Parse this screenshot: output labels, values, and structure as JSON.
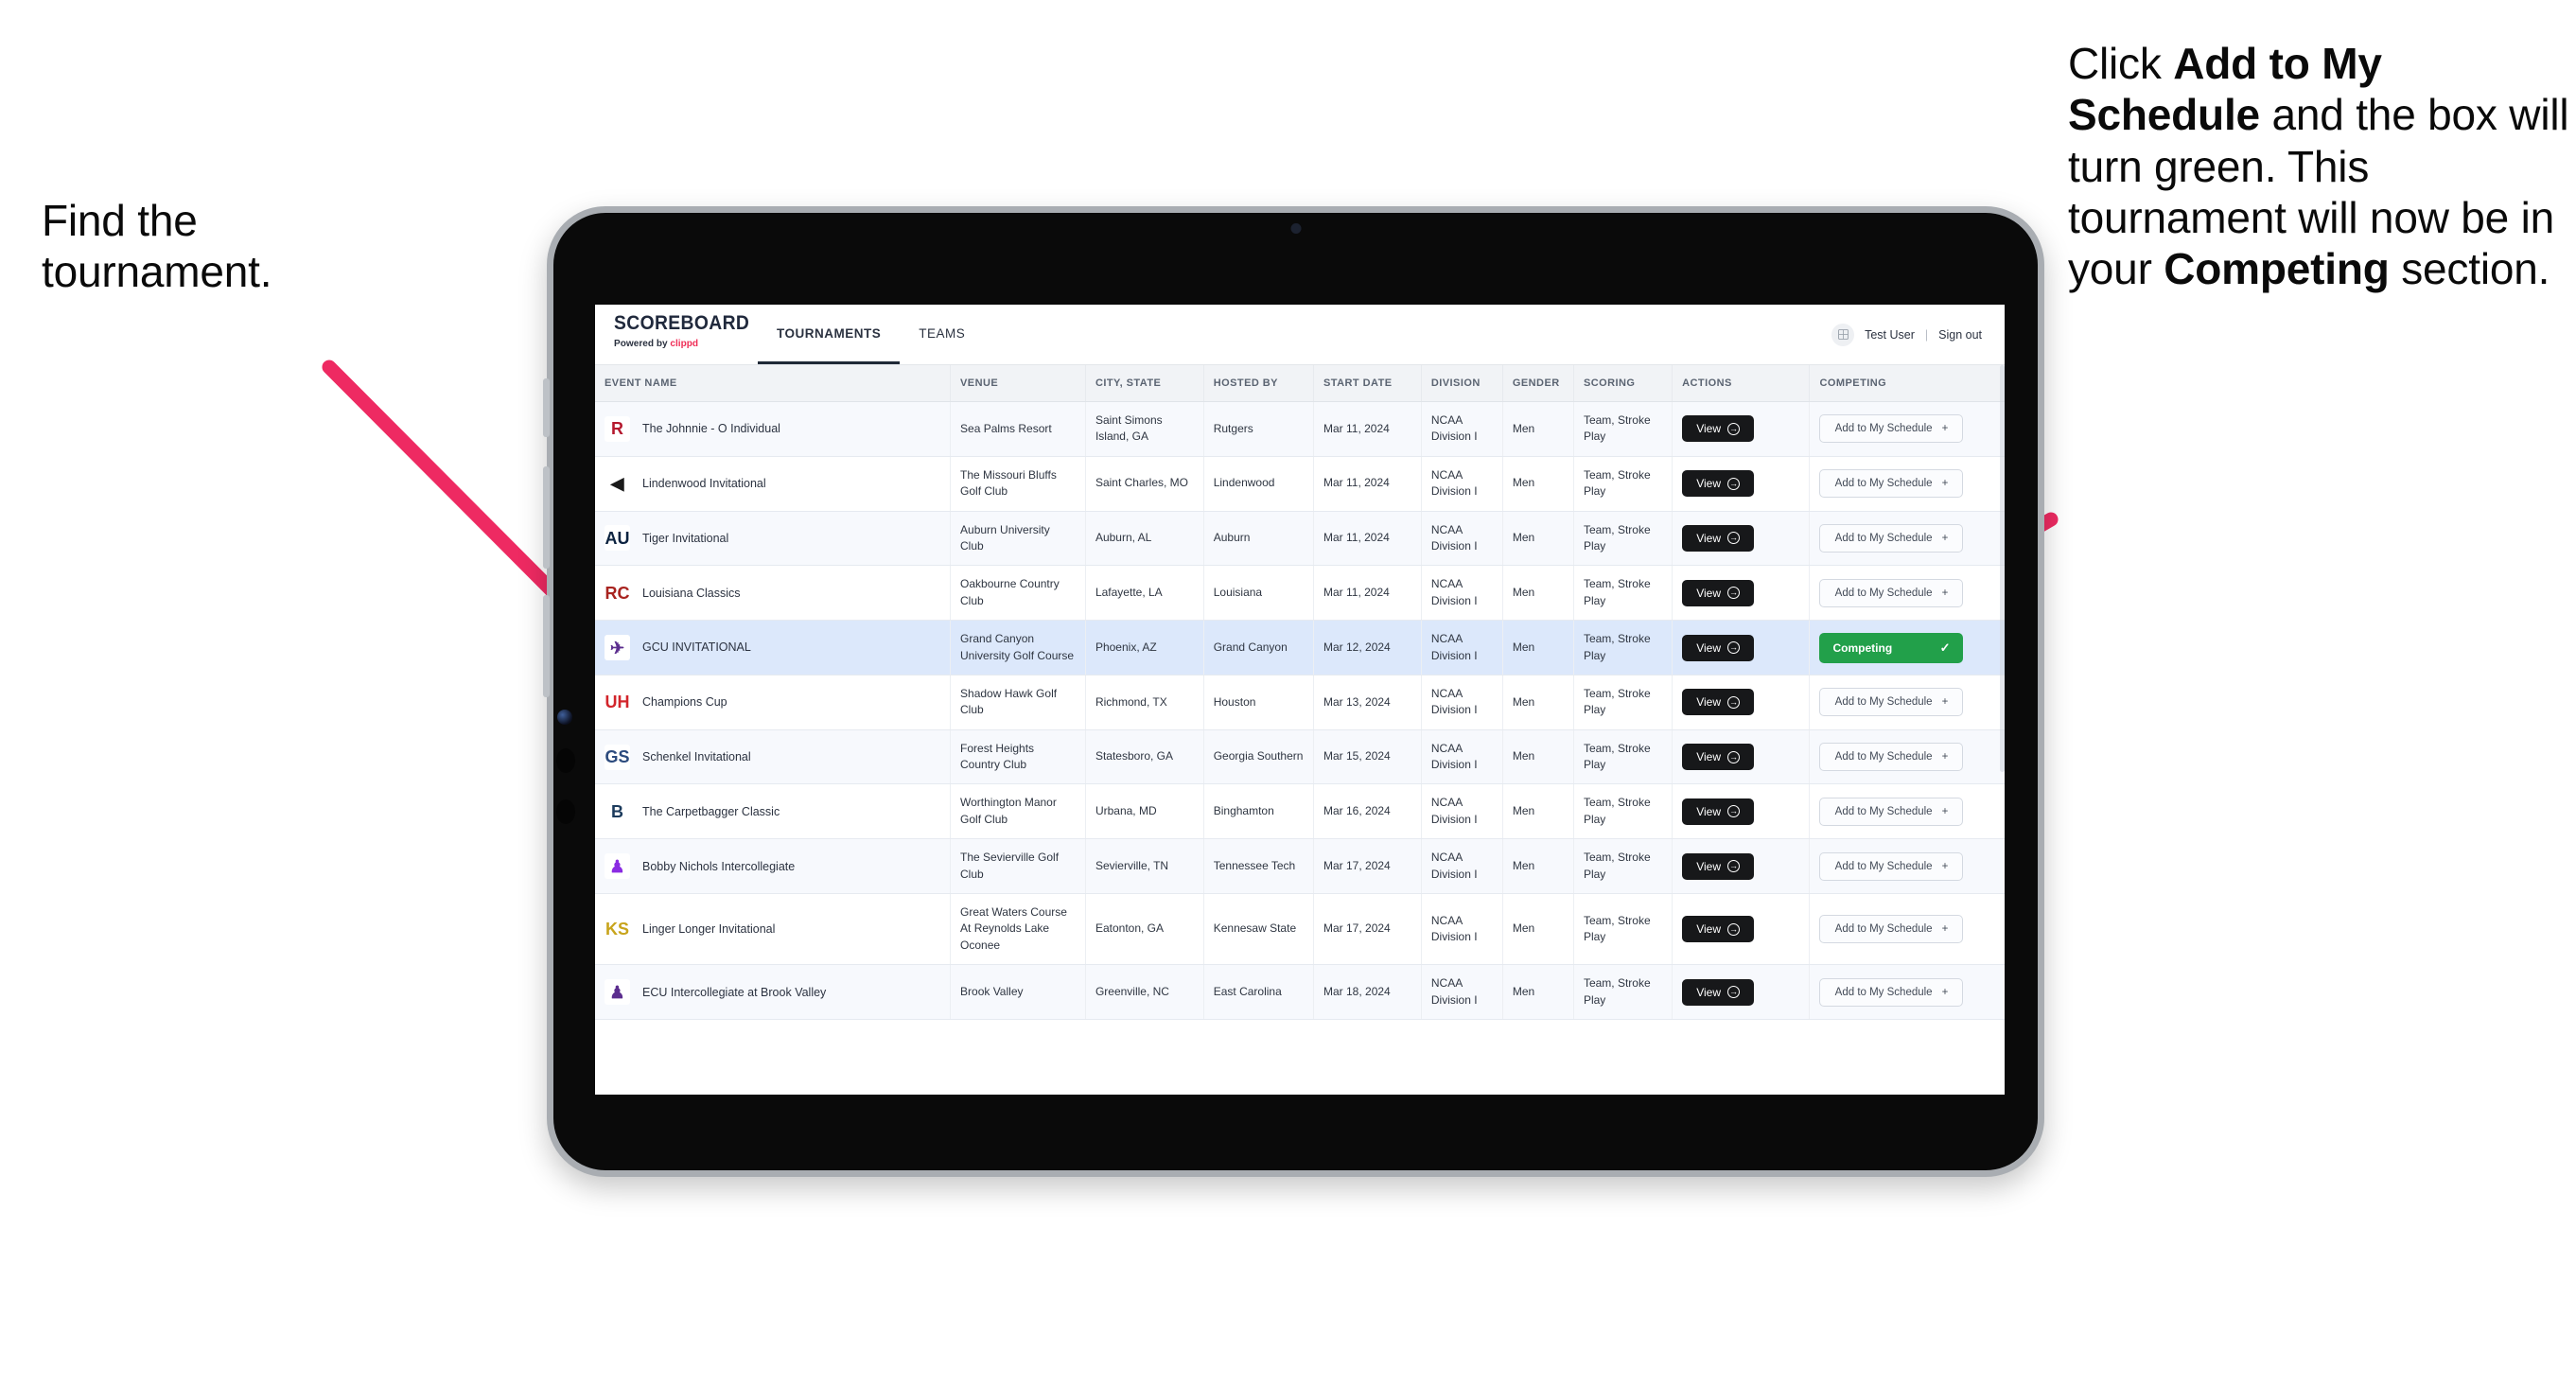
{
  "annotations": {
    "left": {
      "line1": "Find the",
      "line2": "tournament."
    },
    "right": {
      "p1_pre": "Click ",
      "p1_bold": "Add to My Schedule",
      "p1_post": " and the box will turn green. This tournament will now be in your ",
      "p2_bold": "Competing",
      "p2_post": " section."
    }
  },
  "colors": {
    "arrow": "#ee2a62",
    "competing_green": "#22a04a",
    "accent_clippd": "#ef2d56",
    "row_highlight": "#dce8fb",
    "button_dark": "#17181a"
  },
  "app": {
    "brand": {
      "title": "SCOREBOARD",
      "powered_prefix": "Powered by ",
      "powered_brand": "clippd"
    },
    "nav": [
      {
        "label": "TOURNAMENTS",
        "active": true
      },
      {
        "label": "TEAMS",
        "active": false
      }
    ],
    "header_right": {
      "avatar_icon": "user-grid-icon",
      "user": "Test User",
      "separator": "|",
      "signout": "Sign out"
    },
    "table": {
      "columns": [
        "EVENT NAME",
        "VENUE",
        "CITY, STATE",
        "HOSTED BY",
        "START DATE",
        "DIVISION",
        "GENDER",
        "SCORING",
        "ACTIONS",
        "COMPETING"
      ],
      "action_label": "View",
      "add_label": "Add to My Schedule",
      "add_icon": "plus-icon",
      "competing_label": "Competing",
      "competing_icon": "check-icon",
      "rows": [
        {
          "event": "The Johnnie - O Individual",
          "logo": "R",
          "logo_bg": "#ffffff",
          "logo_fg": "#b4182d",
          "venue": "Sea Palms Resort",
          "city": "Saint Simons Island, GA",
          "host": "Rutgers",
          "date": "Mar 11, 2024",
          "division": "NCAA Division I",
          "gender": "Men",
          "scoring": "Team, Stroke Play",
          "competing": false,
          "highlight": false
        },
        {
          "event": "Lindenwood Invitational",
          "logo": "◀",
          "logo_bg": "#ffffff",
          "logo_fg": "#1a1a1a",
          "venue": "The Missouri Bluffs Golf Club",
          "city": "Saint Charles, MO",
          "host": "Lindenwood",
          "date": "Mar 11, 2024",
          "division": "NCAA Division I",
          "gender": "Men",
          "scoring": "Team, Stroke Play",
          "competing": false,
          "highlight": false
        },
        {
          "event": "Tiger Invitational",
          "logo": "AU",
          "logo_bg": "#ffffff",
          "logo_fg": "#0c2340",
          "venue": "Auburn University Club",
          "city": "Auburn, AL",
          "host": "Auburn",
          "date": "Mar 11, 2024",
          "division": "NCAA Division I",
          "gender": "Men",
          "scoring": "Team, Stroke Play",
          "competing": false,
          "highlight": false
        },
        {
          "event": "Louisiana Classics",
          "logo": "RC",
          "logo_bg": "#ffffff",
          "logo_fg": "#a8231f",
          "venue": "Oakbourne Country Club",
          "city": "Lafayette, LA",
          "host": "Louisiana",
          "date": "Mar 11, 2024",
          "division": "NCAA Division I",
          "gender": "Men",
          "scoring": "Team, Stroke Play",
          "competing": false,
          "highlight": false
        },
        {
          "event": "GCU INVITATIONAL",
          "logo": "✈",
          "logo_bg": "#ffffff",
          "logo_fg": "#5b2d8e",
          "venue": "Grand Canyon University Golf Course",
          "city": "Phoenix, AZ",
          "host": "Grand Canyon",
          "date": "Mar 12, 2024",
          "division": "NCAA Division I",
          "gender": "Men",
          "scoring": "Team, Stroke Play",
          "competing": true,
          "highlight": true
        },
        {
          "event": "Champions Cup",
          "logo": "UH",
          "logo_bg": "#ffffff",
          "logo_fg": "#d2252b",
          "venue": "Shadow Hawk Golf Club",
          "city": "Richmond, TX",
          "host": "Houston",
          "date": "Mar 13, 2024",
          "division": "NCAA Division I",
          "gender": "Men",
          "scoring": "Team, Stroke Play",
          "competing": false,
          "highlight": false
        },
        {
          "event": "Schenkel Invitational",
          "logo": "GS",
          "logo_bg": "#ffffff",
          "logo_fg": "#2b4a7d",
          "venue": "Forest Heights Country Club",
          "city": "Statesboro, GA",
          "host": "Georgia Southern",
          "date": "Mar 15, 2024",
          "division": "NCAA Division I",
          "gender": "Men",
          "scoring": "Team, Stroke Play",
          "competing": false,
          "highlight": false
        },
        {
          "event": "The Carpetbagger Classic",
          "logo": "B",
          "logo_bg": "#ffffff",
          "logo_fg": "#1b3a5c",
          "venue": "Worthington Manor Golf Club",
          "city": "Urbana, MD",
          "host": "Binghamton",
          "date": "Mar 16, 2024",
          "division": "NCAA Division I",
          "gender": "Men",
          "scoring": "Team, Stroke Play",
          "competing": false,
          "highlight": false
        },
        {
          "event": "Bobby Nichols Intercollegiate",
          "logo": "♟",
          "logo_bg": "#ffffff",
          "logo_fg": "#8a2be2",
          "venue": "The Sevierville Golf Club",
          "city": "Sevierville, TN",
          "host": "Tennessee Tech",
          "date": "Mar 17, 2024",
          "division": "NCAA Division I",
          "gender": "Men",
          "scoring": "Team, Stroke Play",
          "competing": false,
          "highlight": false
        },
        {
          "event": "Linger Longer Invitational",
          "logo": "KS",
          "logo_bg": "#ffffff",
          "logo_fg": "#c8a41c",
          "venue": "Great Waters Course At Reynolds Lake Oconee",
          "city": "Eatonton, GA",
          "host": "Kennesaw State",
          "date": "Mar 17, 2024",
          "division": "NCAA Division I",
          "gender": "Men",
          "scoring": "Team, Stroke Play",
          "competing": false,
          "highlight": false
        },
        {
          "event": "ECU Intercollegiate at Brook Valley",
          "logo": "♟",
          "logo_bg": "#ffffff",
          "logo_fg": "#5b2d8e",
          "venue": "Brook Valley",
          "city": "Greenville, NC",
          "host": "East Carolina",
          "date": "Mar 18, 2024",
          "division": "NCAA Division I",
          "gender": "Men",
          "scoring": "Team, Stroke Play",
          "competing": false,
          "highlight": false
        }
      ]
    }
  }
}
